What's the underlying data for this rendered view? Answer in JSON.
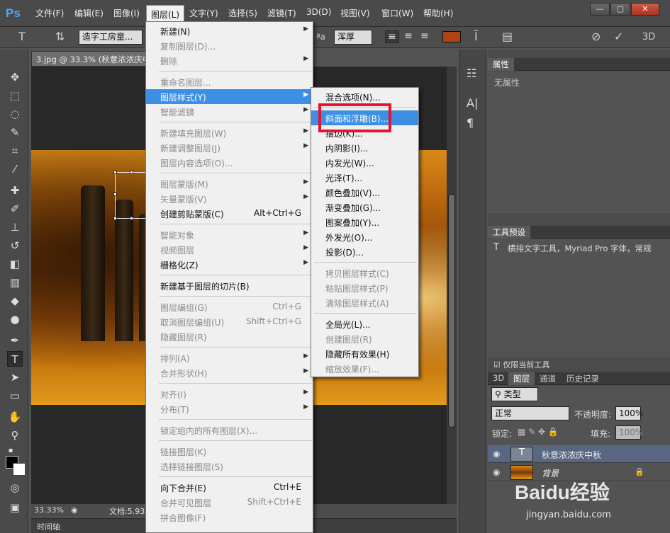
{
  "app": {
    "logo": "Ps"
  },
  "menubar": {
    "items": [
      "文件(F)",
      "编辑(E)",
      "图像(I)",
      "图层(L)",
      "文字(Y)",
      "选择(S)",
      "滤镜(T)",
      "3D(D)",
      "视图(V)",
      "窗口(W)",
      "帮助(H)"
    ],
    "active": "图层(L)",
    "window_controls": [
      "—",
      "▢",
      "✕"
    ]
  },
  "options_bar": {
    "font_family": "造字工房童...",
    "anti_alias": "浑厚",
    "text_color": "#b24113",
    "aa_glyph": "ªa"
  },
  "document": {
    "tab_title": "3.jpg @ 33.3% (秋意浓浓庆中",
    "zoom": "33.33%",
    "doc_info": "文档:5.93",
    "timeline_label": "时间轴"
  },
  "layer_menu": {
    "items": [
      {
        "label": "新建(N)",
        "arrow": true
      },
      {
        "label": "复制图层(D)...",
        "disabled": true
      },
      {
        "label": "删除",
        "arrow": true,
        "disabled": true
      },
      {
        "sep": true
      },
      {
        "label": "重命名图层...",
        "disabled": true
      },
      {
        "label": "图层样式(Y)",
        "arrow": true,
        "highlight": true
      },
      {
        "label": "智能滤镜",
        "arrow": true,
        "disabled": true
      },
      {
        "sep": true
      },
      {
        "label": "新建填充图层(W)",
        "arrow": true,
        "disabled": true
      },
      {
        "label": "新建调整图层(J)",
        "arrow": true,
        "disabled": true
      },
      {
        "label": "图层内容选项(O)...",
        "disabled": true
      },
      {
        "sep": true
      },
      {
        "label": "图层蒙版(M)",
        "arrow": true,
        "disabled": true
      },
      {
        "label": "矢量蒙版(V)",
        "arrow": true,
        "disabled": true
      },
      {
        "label": "创建剪贴蒙版(C)",
        "shortcut": "Alt+Ctrl+G"
      },
      {
        "sep": true
      },
      {
        "label": "智能对象",
        "arrow": true,
        "disabled": true
      },
      {
        "label": "视频图层",
        "arrow": true,
        "disabled": true
      },
      {
        "label": "栅格化(Z)",
        "arrow": true
      },
      {
        "sep": true
      },
      {
        "label": "新建基于图层的切片(B)"
      },
      {
        "sep": true
      },
      {
        "label": "图层编组(G)",
        "shortcut": "Ctrl+G",
        "disabled": true
      },
      {
        "label": "取消图层编组(U)",
        "shortcut": "Shift+Ctrl+G",
        "disabled": true
      },
      {
        "label": "隐藏图层(R)",
        "disabled": true
      },
      {
        "sep": true
      },
      {
        "label": "排列(A)",
        "arrow": true,
        "disabled": true
      },
      {
        "label": "合并形状(H)",
        "arrow": true,
        "disabled": true
      },
      {
        "sep": true
      },
      {
        "label": "对齐(I)",
        "arrow": true,
        "disabled": true
      },
      {
        "label": "分布(T)",
        "arrow": true,
        "disabled": true
      },
      {
        "sep": true
      },
      {
        "label": "锁定组内的所有图层(X)...",
        "disabled": true
      },
      {
        "sep": true
      },
      {
        "label": "链接图层(K)",
        "disabled": true
      },
      {
        "label": "选择链接图层(S)",
        "disabled": true
      },
      {
        "sep": true
      },
      {
        "label": "向下合并(E)",
        "shortcut": "Ctrl+E"
      },
      {
        "label": "合并可见图层",
        "shortcut": "Shift+Ctrl+E",
        "disabled": true
      },
      {
        "label": "拼合图像(F)",
        "disabled": true
      }
    ]
  },
  "style_submenu": {
    "items": [
      {
        "label": "混合选项(N)..."
      },
      {
        "sep": true
      },
      {
        "label": "斜面和浮雕(B)...",
        "highlight": true
      },
      {
        "label": "描边(K)..."
      },
      {
        "label": "内阴影(I)..."
      },
      {
        "label": "内发光(W)..."
      },
      {
        "label": "光泽(T)..."
      },
      {
        "label": "颜色叠加(V)..."
      },
      {
        "label": "渐变叠加(G)..."
      },
      {
        "label": "图案叠加(Y)..."
      },
      {
        "label": "外发光(O)..."
      },
      {
        "label": "投影(D)..."
      },
      {
        "sep": true
      },
      {
        "label": "拷贝图层样式(C)",
        "disabled": true
      },
      {
        "label": "粘贴图层样式(P)",
        "disabled": true
      },
      {
        "label": "清除图层样式(A)",
        "disabled": true
      },
      {
        "sep": true
      },
      {
        "label": "全局光(L)..."
      },
      {
        "label": "创建图层(R)",
        "disabled": true
      },
      {
        "label": "隐藏所有效果(H)"
      },
      {
        "label": "缩放效果(F)...",
        "disabled": true
      }
    ]
  },
  "properties_panel": {
    "tab": "属性",
    "content": "无属性"
  },
  "tool_presets_panel": {
    "tab": "工具预设",
    "entry": "横排文字工具，Myriad Pro 字体，常规",
    "current_tool_only": "仅限当前工具"
  },
  "layers_panel": {
    "tabs": [
      "3D",
      "图层",
      "通道",
      "历史记录"
    ],
    "active_tab": "图层",
    "filter": "类型",
    "blend_mode": "正常",
    "opacity_label": "不透明度:",
    "opacity": "100%",
    "lock_label": "锁定:",
    "fill_label": "填充:",
    "fill": "100%",
    "layers": [
      {
        "name": "秋意浓浓庆中秋",
        "type": "text",
        "selected": true
      },
      {
        "name": "背景",
        "type": "image",
        "locked": true
      }
    ]
  },
  "watermark": {
    "brand": "Baidu经验",
    "url": "jingyan.baidu.com"
  }
}
